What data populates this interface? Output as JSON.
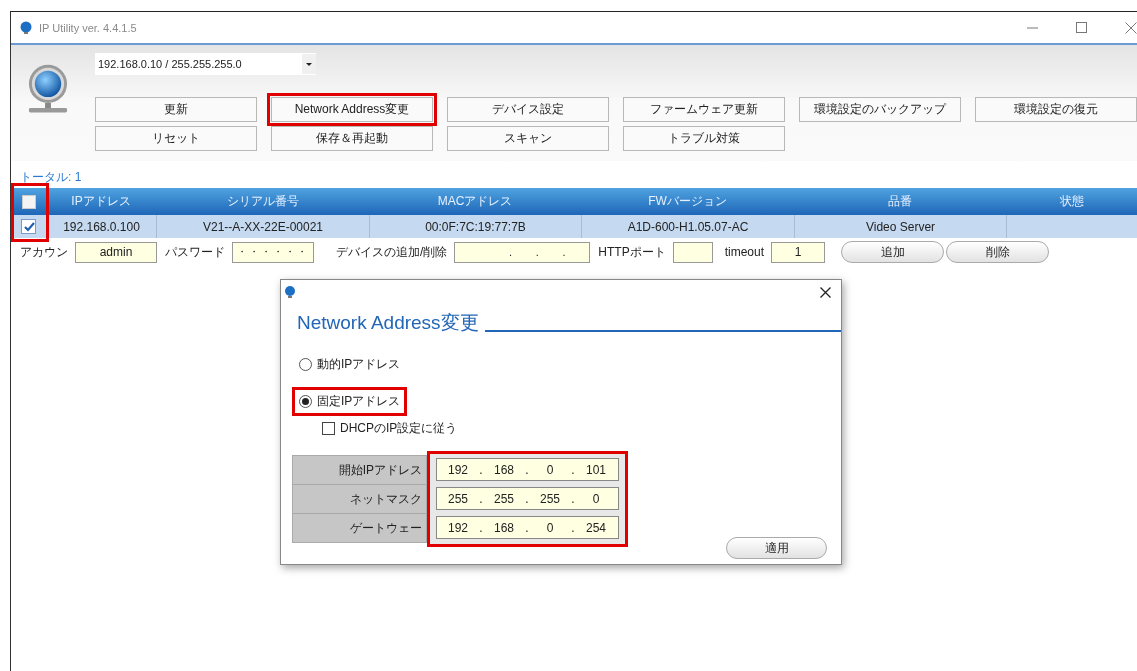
{
  "window": {
    "title": "IP Utility ver. 4.4.1.5"
  },
  "interface_select": {
    "value": "192.168.0.10 / 255.255.255.0"
  },
  "toolbar_rows": [
    {
      "buttons": [
        {
          "label": "更新",
          "highlighted": false
        },
        {
          "label": "Network Address変更",
          "highlighted": true
        },
        {
          "label": "デバイス設定",
          "highlighted": false
        },
        {
          "label": "ファームウェア更新",
          "highlighted": false
        },
        {
          "label": "環境設定のバックアップ",
          "highlighted": false
        },
        {
          "label": "環境設定の復元",
          "highlighted": false
        }
      ]
    },
    {
      "buttons": [
        {
          "label": "リセット",
          "highlighted": false
        },
        {
          "label": "保存＆再起動",
          "highlighted": false
        },
        {
          "label": "スキャン",
          "highlighted": false
        },
        {
          "label": "トラブル対策",
          "highlighted": false
        }
      ]
    }
  ],
  "total": "トータル: 1",
  "table": {
    "select_all": {
      "checked": false
    },
    "checkbox_column_highlighted": true,
    "columns": [
      "IPアドレス",
      "シリアル番号",
      "MACアドレス",
      "FWバージョン",
      "品番",
      "状態"
    ],
    "rows": [
      {
        "checked": true,
        "selected": true,
        "cells": [
          "192.168.0.100",
          "V21--A-XX-22E-00021",
          "00:0F:7C:19:77:7B",
          "A1D-600-H1.05.07-AC",
          "Video Server"
        ]
      }
    ]
  },
  "add_device": {
    "account_label": "アカウン",
    "account": "admin",
    "password_label": "パスワード",
    "password": "・・・・・・",
    "device_label": "デバイスの追加/削除",
    "device_ip_separators": [
      ".",
      ".",
      "."
    ],
    "http_label": "HTTPポート",
    "timeout_label": "timeout",
    "timeout": "1",
    "buttons": [
      "追加",
      "削除"
    ]
  },
  "dialog": {
    "heading": "Network Address変更",
    "modes": [
      {
        "label": "動的IPアドレス",
        "selected": false,
        "highlighted": false
      },
      {
        "label": "固定IPアドレス",
        "selected": true,
        "highlighted": true
      }
    ],
    "dhcp": {
      "label": "DHCPのIP設定に従う",
      "checked": false
    },
    "fields_highlighted": true,
    "separator": ".",
    "fields": [
      {
        "label": "開始IPアドレス",
        "octets": [
          "192",
          "168",
          "0",
          "101"
        ]
      },
      {
        "label": "ネットマスク",
        "octets": [
          "255",
          "255",
          "255",
          "0"
        ]
      },
      {
        "label": "ゲートウェー",
        "octets": [
          "192",
          "168",
          "0",
          "254"
        ]
      }
    ],
    "apply": "適用"
  }
}
